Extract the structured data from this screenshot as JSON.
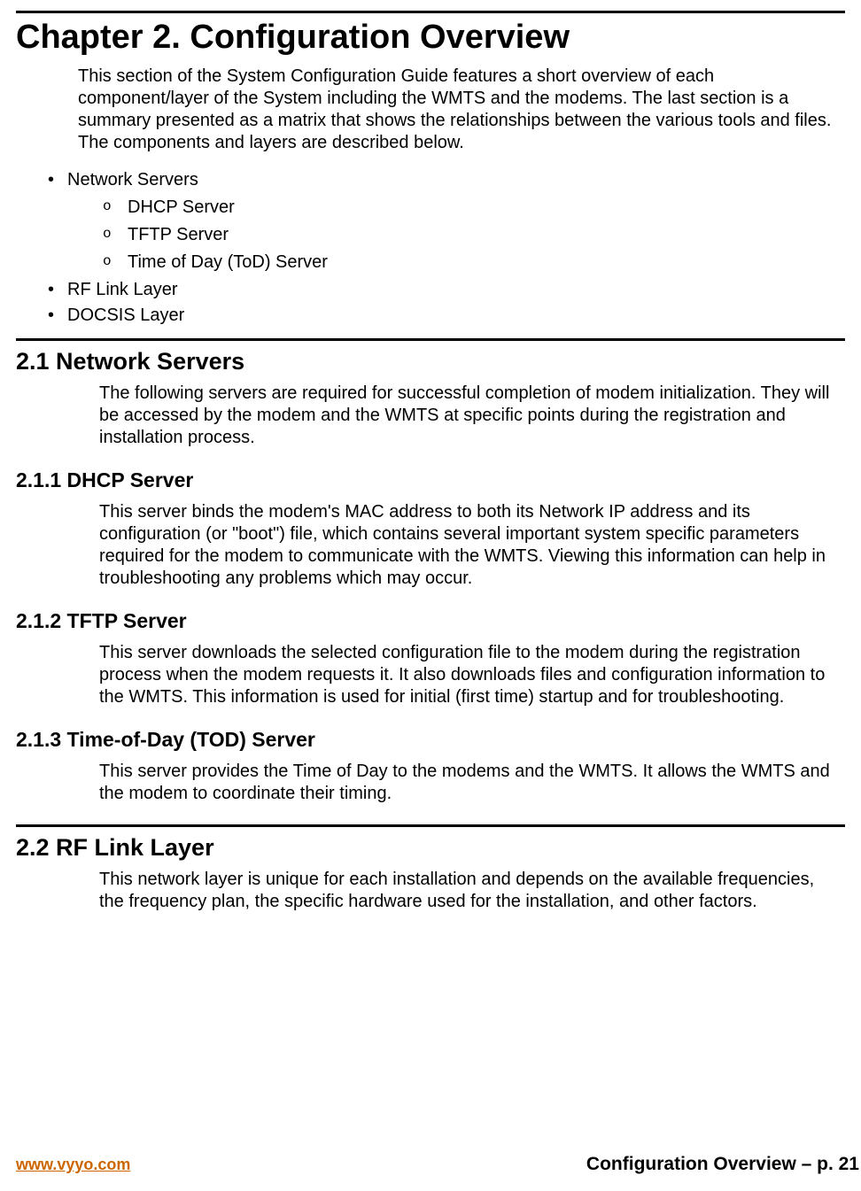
{
  "chapter": {
    "title": "Chapter 2.  Configuration Overview",
    "intro": "This section of the System Configuration Guide features a short overview of each component/layer of the System including the WMTS and the modems.  The last section is a summary presented as a matrix that shows the relationships between the various tools and files.  The components and layers are described below."
  },
  "bullets": {
    "network_servers": "Network Servers",
    "dhcp": "DHCP Server",
    "tftp": "TFTP Server",
    "tod": "Time of Day (ToD) Server",
    "rf_link": "RF Link Layer",
    "docsis": "DOCSIS Layer"
  },
  "section_2_1": {
    "heading": "2.1  Network Servers",
    "body": "The following servers are required for successful completion of modem initialization.  They will be accessed by the modem and the WMTS at specific points during the registration and installation process."
  },
  "section_2_1_1": {
    "heading": "2.1.1 DHCP Server",
    "body": "This server binds the modem's MAC address to both its Network IP address and its configuration (or \"boot\") file, which contains several important system specific parameters required for the modem to communicate with the WMTS.  Viewing this information can help in troubleshooting any problems which may occur."
  },
  "section_2_1_2": {
    "heading": "2.1.2 TFTP Server",
    "body": "This server downloads the selected configuration file to the modem during the registration process when the modem requests it.  It also downloads files and configuration information to the WMTS.  This information is used for initial (first time) startup and for troubleshooting."
  },
  "section_2_1_3": {
    "heading": "2.1.3 Time-of-Day (TOD) Server",
    "body": "This server provides the Time of Day to the modems and the WMTS. It allows the WMTS and the modem to coordinate their timing."
  },
  "section_2_2": {
    "heading": "2.2   RF Link Layer",
    "body": "This network layer is unique for each installation and depends on the available frequencies, the frequency plan, the specific hardware used for the installation, and other factors."
  },
  "footer": {
    "url": "www.vyyo.com",
    "page_label": "Configuration Overview – p. 21"
  }
}
